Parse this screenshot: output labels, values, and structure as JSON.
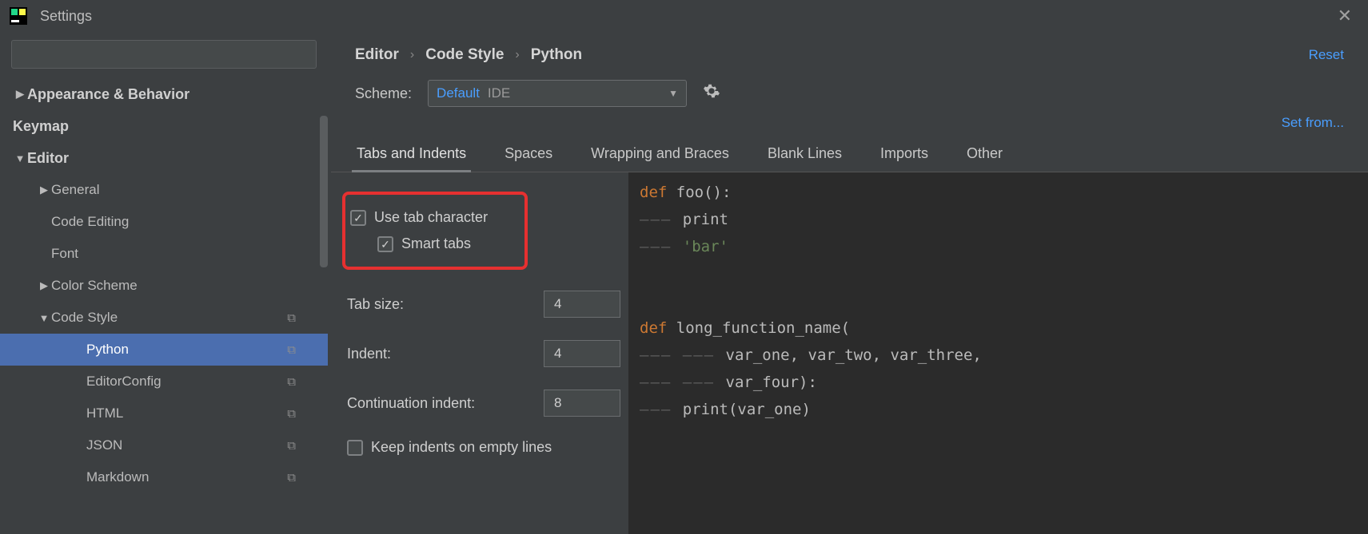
{
  "window_title": "Settings",
  "sidebar": {
    "items": [
      {
        "label": "Appearance & Behavior",
        "arrow": "▶",
        "depth": 0
      },
      {
        "label": "Keymap",
        "arrow": "",
        "depth": 0
      },
      {
        "label": "Editor",
        "arrow": "▼",
        "depth": 0
      },
      {
        "label": "General",
        "arrow": "▶",
        "depth": 1
      },
      {
        "label": "Code Editing",
        "arrow": "",
        "depth": 1
      },
      {
        "label": "Font",
        "arrow": "",
        "depth": 1
      },
      {
        "label": "Color Scheme",
        "arrow": "▶",
        "depth": 1
      },
      {
        "label": "Code Style",
        "arrow": "▼",
        "depth": 1,
        "scheme_icon": true
      },
      {
        "label": "Python",
        "arrow": "",
        "depth": 2,
        "selected": true,
        "scheme_icon": true
      },
      {
        "label": "EditorConfig",
        "arrow": "",
        "depth": 2,
        "scheme_icon": true
      },
      {
        "label": "HTML",
        "arrow": "",
        "depth": 2,
        "scheme_icon": true
      },
      {
        "label": "JSON",
        "arrow": "",
        "depth": 2,
        "scheme_icon": true
      },
      {
        "label": "Markdown",
        "arrow": "",
        "depth": 2,
        "scheme_icon": true
      }
    ]
  },
  "breadcrumb": [
    "Editor",
    "Code Style",
    "Python"
  ],
  "reset_label": "Reset",
  "scheme": {
    "label": "Scheme:",
    "value_primary": "Default",
    "value_secondary": "IDE"
  },
  "set_from_label": "Set from...",
  "tabs": [
    {
      "label": "Tabs and Indents",
      "active": true
    },
    {
      "label": "Spaces"
    },
    {
      "label": "Wrapping and Braces"
    },
    {
      "label": "Blank Lines"
    },
    {
      "label": "Imports"
    },
    {
      "label": "Other"
    }
  ],
  "settings": {
    "use_tab_char": {
      "label": "Use tab character",
      "checked": true
    },
    "smart_tabs": {
      "label": "Smart tabs",
      "checked": true
    },
    "tab_size": {
      "label": "Tab size:",
      "value": "4"
    },
    "indent": {
      "label": "Indent:",
      "value": "4"
    },
    "cont_indent": {
      "label": "Continuation indent:",
      "value": "8"
    },
    "keep_empty": {
      "label": "Keep indents on empty lines",
      "checked": false
    }
  },
  "preview": {
    "t_def": "def",
    "t_foo": " foo():",
    "t_print": "print",
    "t_bar": "'bar'",
    "t_long": " long_function_name(",
    "t_vars1a": "var_one",
    "t_vars1b": " var_two",
    "t_vars1c": " var_three",
    "t_vars2": "var_four):",
    "t_print2": "print(var_one)",
    "ind": "——— "
  }
}
